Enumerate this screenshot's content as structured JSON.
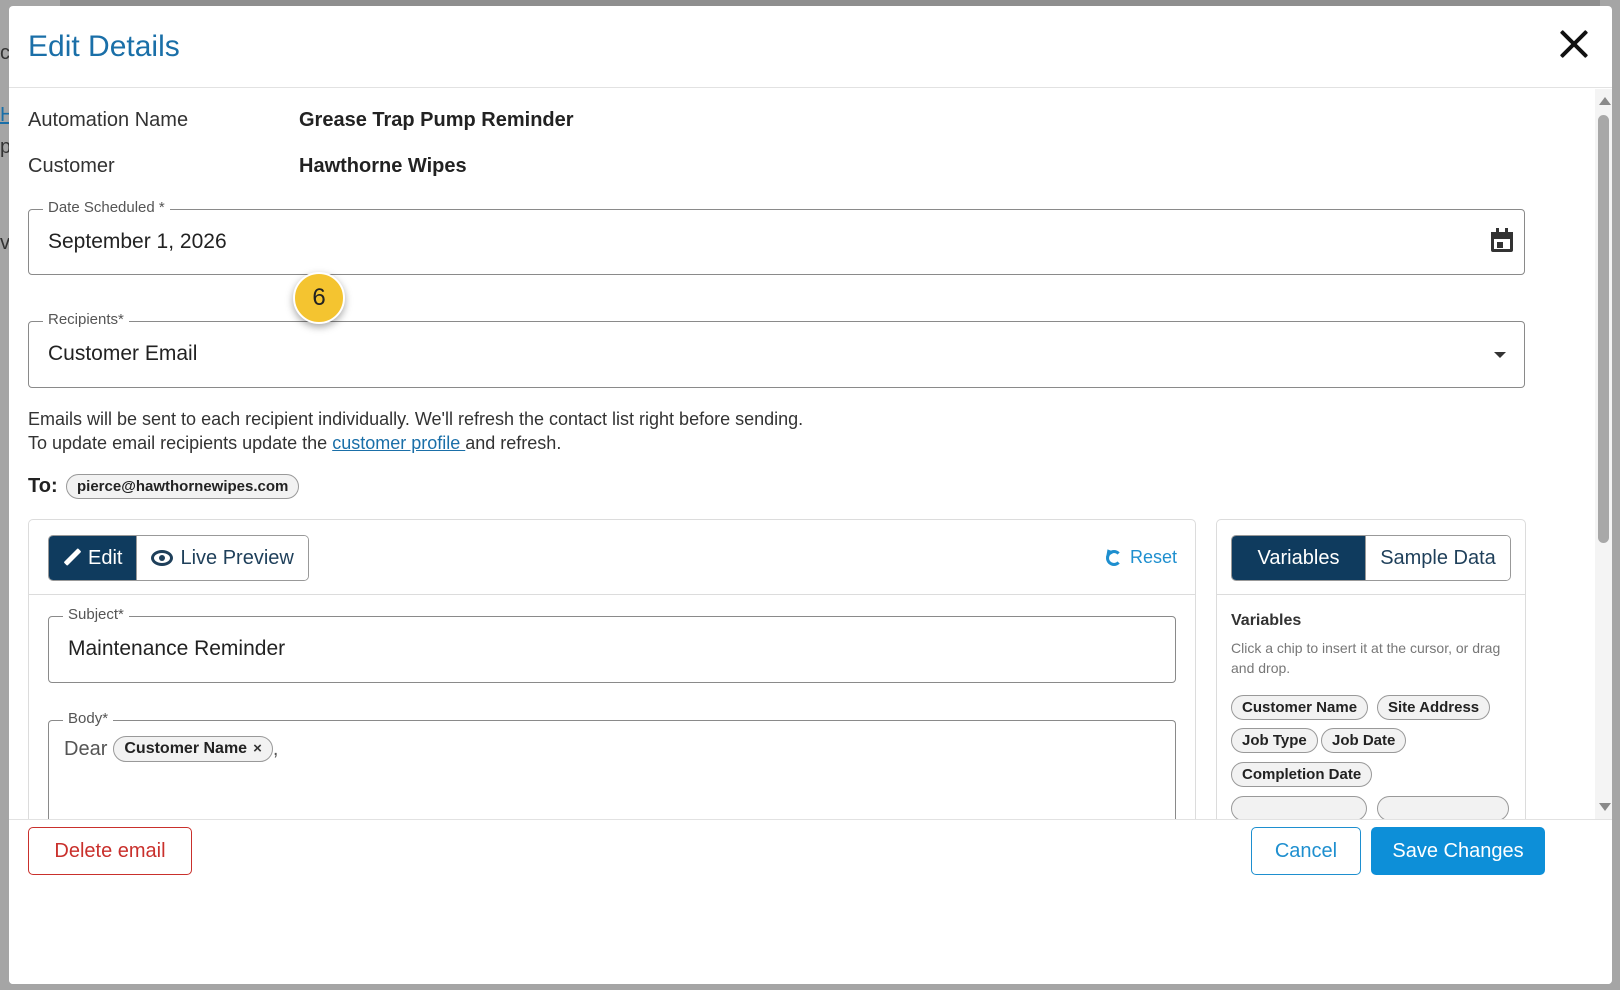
{
  "background": {
    "fragments": [
      "c",
      "H",
      "p",
      "vi"
    ]
  },
  "modal": {
    "title": "Edit Details"
  },
  "info": {
    "automation_name_label": "Automation Name",
    "automation_name_value": "Grease Trap Pump Reminder",
    "customer_label": "Customer",
    "customer_value": "Hawthorne Wipes"
  },
  "date_field": {
    "label": "Date Scheduled *",
    "value": "September 1, 2026"
  },
  "step_badge": "6",
  "recipients_field": {
    "label": "Recipients*",
    "value": "Customer Email"
  },
  "helper": {
    "line1": "Emails will be sent to each recipient individually. We'll refresh the contact list right before sending.",
    "line2_prefix": "To update email recipients update the ",
    "line2_link": "customer profile ",
    "line2_suffix": "and refresh."
  },
  "to": {
    "label": "To:",
    "email": "pierce@hawthornewipes.com"
  },
  "editor": {
    "tab_edit": "Edit",
    "tab_preview": "Live Preview",
    "reset": "Reset",
    "subject_label": "Subject*",
    "subject_value": "Maintenance Reminder",
    "body_label": "Body*",
    "body_prefix": "Dear",
    "body_chip": "Customer Name",
    "body_chip_remove": "×",
    "body_suffix": ","
  },
  "variables": {
    "tab_variables": "Variables",
    "tab_sample": "Sample Data",
    "title": "Variables",
    "help": "Click a chip to insert it at the cursor, or drag and drop.",
    "chips": [
      "Customer Name",
      "Site Address",
      "Job Type",
      "Job Date",
      "Completion Date"
    ]
  },
  "footer": {
    "delete": "Delete email",
    "cancel": "Cancel",
    "save": "Save Changes"
  },
  "colors": {
    "title_blue": "#1a6fa8",
    "primary": "#0d8fd8",
    "segment_active": "#0f3b5e",
    "danger": "#c9302c",
    "badge": "#f4c430"
  }
}
